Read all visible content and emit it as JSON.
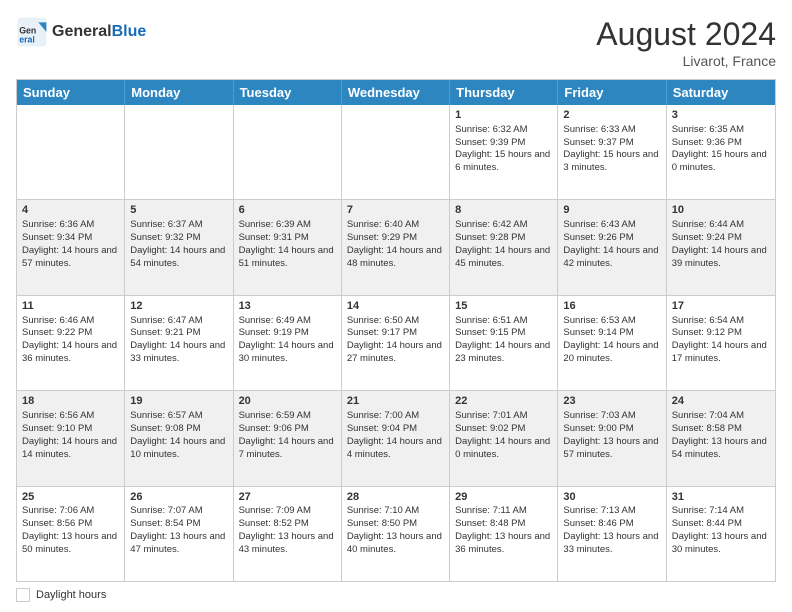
{
  "header": {
    "logo_general": "General",
    "logo_blue": "Blue",
    "month_year": "August 2024",
    "location": "Livarot, France"
  },
  "legend": {
    "label": "Daylight hours"
  },
  "days_of_week": [
    "Sunday",
    "Monday",
    "Tuesday",
    "Wednesday",
    "Thursday",
    "Friday",
    "Saturday"
  ],
  "weeks": [
    [
      {
        "day": "",
        "sunrise": "",
        "sunset": "",
        "daylight": ""
      },
      {
        "day": "",
        "sunrise": "",
        "sunset": "",
        "daylight": ""
      },
      {
        "day": "",
        "sunrise": "",
        "sunset": "",
        "daylight": ""
      },
      {
        "day": "",
        "sunrise": "",
        "sunset": "",
        "daylight": ""
      },
      {
        "day": "1",
        "sunrise": "Sunrise: 6:32 AM",
        "sunset": "Sunset: 9:39 PM",
        "daylight": "Daylight: 15 hours and 6 minutes."
      },
      {
        "day": "2",
        "sunrise": "Sunrise: 6:33 AM",
        "sunset": "Sunset: 9:37 PM",
        "daylight": "Daylight: 15 hours and 3 minutes."
      },
      {
        "day": "3",
        "sunrise": "Sunrise: 6:35 AM",
        "sunset": "Sunset: 9:36 PM",
        "daylight": "Daylight: 15 hours and 0 minutes."
      }
    ],
    [
      {
        "day": "4",
        "sunrise": "Sunrise: 6:36 AM",
        "sunset": "Sunset: 9:34 PM",
        "daylight": "Daylight: 14 hours and 57 minutes."
      },
      {
        "day": "5",
        "sunrise": "Sunrise: 6:37 AM",
        "sunset": "Sunset: 9:32 PM",
        "daylight": "Daylight: 14 hours and 54 minutes."
      },
      {
        "day": "6",
        "sunrise": "Sunrise: 6:39 AM",
        "sunset": "Sunset: 9:31 PM",
        "daylight": "Daylight: 14 hours and 51 minutes."
      },
      {
        "day": "7",
        "sunrise": "Sunrise: 6:40 AM",
        "sunset": "Sunset: 9:29 PM",
        "daylight": "Daylight: 14 hours and 48 minutes."
      },
      {
        "day": "8",
        "sunrise": "Sunrise: 6:42 AM",
        "sunset": "Sunset: 9:28 PM",
        "daylight": "Daylight: 14 hours and 45 minutes."
      },
      {
        "day": "9",
        "sunrise": "Sunrise: 6:43 AM",
        "sunset": "Sunset: 9:26 PM",
        "daylight": "Daylight: 14 hours and 42 minutes."
      },
      {
        "day": "10",
        "sunrise": "Sunrise: 6:44 AM",
        "sunset": "Sunset: 9:24 PM",
        "daylight": "Daylight: 14 hours and 39 minutes."
      }
    ],
    [
      {
        "day": "11",
        "sunrise": "Sunrise: 6:46 AM",
        "sunset": "Sunset: 9:22 PM",
        "daylight": "Daylight: 14 hours and 36 minutes."
      },
      {
        "day": "12",
        "sunrise": "Sunrise: 6:47 AM",
        "sunset": "Sunset: 9:21 PM",
        "daylight": "Daylight: 14 hours and 33 minutes."
      },
      {
        "day": "13",
        "sunrise": "Sunrise: 6:49 AM",
        "sunset": "Sunset: 9:19 PM",
        "daylight": "Daylight: 14 hours and 30 minutes."
      },
      {
        "day": "14",
        "sunrise": "Sunrise: 6:50 AM",
        "sunset": "Sunset: 9:17 PM",
        "daylight": "Daylight: 14 hours and 27 minutes."
      },
      {
        "day": "15",
        "sunrise": "Sunrise: 6:51 AM",
        "sunset": "Sunset: 9:15 PM",
        "daylight": "Daylight: 14 hours and 23 minutes."
      },
      {
        "day": "16",
        "sunrise": "Sunrise: 6:53 AM",
        "sunset": "Sunset: 9:14 PM",
        "daylight": "Daylight: 14 hours and 20 minutes."
      },
      {
        "day": "17",
        "sunrise": "Sunrise: 6:54 AM",
        "sunset": "Sunset: 9:12 PM",
        "daylight": "Daylight: 14 hours and 17 minutes."
      }
    ],
    [
      {
        "day": "18",
        "sunrise": "Sunrise: 6:56 AM",
        "sunset": "Sunset: 9:10 PM",
        "daylight": "Daylight: 14 hours and 14 minutes."
      },
      {
        "day": "19",
        "sunrise": "Sunrise: 6:57 AM",
        "sunset": "Sunset: 9:08 PM",
        "daylight": "Daylight: 14 hours and 10 minutes."
      },
      {
        "day": "20",
        "sunrise": "Sunrise: 6:59 AM",
        "sunset": "Sunset: 9:06 PM",
        "daylight": "Daylight: 14 hours and 7 minutes."
      },
      {
        "day": "21",
        "sunrise": "Sunrise: 7:00 AM",
        "sunset": "Sunset: 9:04 PM",
        "daylight": "Daylight: 14 hours and 4 minutes."
      },
      {
        "day": "22",
        "sunrise": "Sunrise: 7:01 AM",
        "sunset": "Sunset: 9:02 PM",
        "daylight": "Daylight: 14 hours and 0 minutes."
      },
      {
        "day": "23",
        "sunrise": "Sunrise: 7:03 AM",
        "sunset": "Sunset: 9:00 PM",
        "daylight": "Daylight: 13 hours and 57 minutes."
      },
      {
        "day": "24",
        "sunrise": "Sunrise: 7:04 AM",
        "sunset": "Sunset: 8:58 PM",
        "daylight": "Daylight: 13 hours and 54 minutes."
      }
    ],
    [
      {
        "day": "25",
        "sunrise": "Sunrise: 7:06 AM",
        "sunset": "Sunset: 8:56 PM",
        "daylight": "Daylight: 13 hours and 50 minutes."
      },
      {
        "day": "26",
        "sunrise": "Sunrise: 7:07 AM",
        "sunset": "Sunset: 8:54 PM",
        "daylight": "Daylight: 13 hours and 47 minutes."
      },
      {
        "day": "27",
        "sunrise": "Sunrise: 7:09 AM",
        "sunset": "Sunset: 8:52 PM",
        "daylight": "Daylight: 13 hours and 43 minutes."
      },
      {
        "day": "28",
        "sunrise": "Sunrise: 7:10 AM",
        "sunset": "Sunset: 8:50 PM",
        "daylight": "Daylight: 13 hours and 40 minutes."
      },
      {
        "day": "29",
        "sunrise": "Sunrise: 7:11 AM",
        "sunset": "Sunset: 8:48 PM",
        "daylight": "Daylight: 13 hours and 36 minutes."
      },
      {
        "day": "30",
        "sunrise": "Sunrise: 7:13 AM",
        "sunset": "Sunset: 8:46 PM",
        "daylight": "Daylight: 13 hours and 33 minutes."
      },
      {
        "day": "31",
        "sunrise": "Sunrise: 7:14 AM",
        "sunset": "Sunset: 8:44 PM",
        "daylight": "Daylight: 13 hours and 30 minutes."
      }
    ]
  ]
}
